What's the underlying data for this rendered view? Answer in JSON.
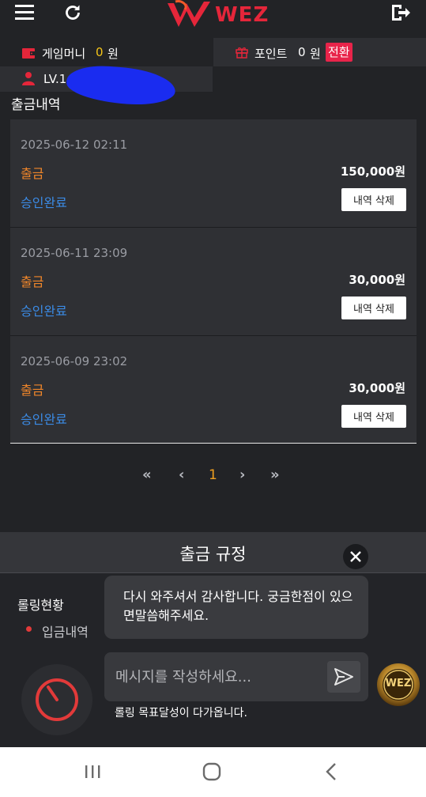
{
  "header": {
    "logo_text": "WEZ",
    "brand_color": "#e5263a"
  },
  "wallet": {
    "game_money_label": "게임머니",
    "game_money_value": "0",
    "game_money_unit": "원",
    "points_label": "포인트",
    "points_value": "0",
    "points_unit": "원",
    "convert_label": "전환"
  },
  "user": {
    "level": "LV.1"
  },
  "page_title": "출금내역",
  "withdrawals": [
    {
      "date": "2025-06-12 02:11",
      "type": "출금",
      "amount": "150,000원",
      "status": "승인완료",
      "delete_label": "내역 삭제"
    },
    {
      "date": "2025-06-11 23:09",
      "type": "출금",
      "amount": "30,000원",
      "status": "승인완료",
      "delete_label": "내역 삭제"
    },
    {
      "date": "2025-06-09 23:02",
      "type": "출금",
      "amount": "30,000원",
      "status": "승인완료",
      "delete_label": "내역 삭제"
    }
  ],
  "pagination": {
    "first": "«",
    "prev": "‹",
    "current": "1",
    "next": "›",
    "last": "»"
  },
  "rules_bar": {
    "title": "출금 규정"
  },
  "sidebar": {
    "rolling_status": "롤링현황",
    "deposit_history": "입금내역"
  },
  "chat": {
    "message": "다시 와주셔서 감사합니다. 궁금한점이 있으면말씀해주세요.",
    "input_placeholder": "메시지를 작성하세요...",
    "rolling_notice": "롤링 목표달성이 다가옵니다."
  },
  "badge": {
    "text": "WEZ"
  },
  "colors": {
    "accent_orange": "#f0862a",
    "status_blue": "#3b8be6",
    "timer_red": "#e23a3a",
    "pagination_current": "#f0a020"
  }
}
